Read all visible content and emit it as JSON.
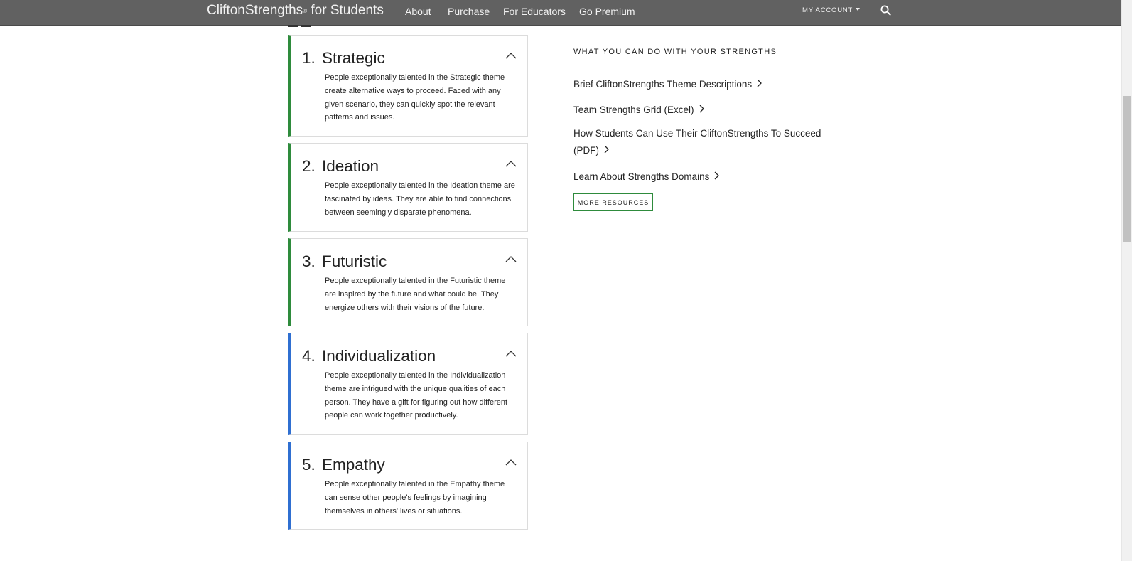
{
  "header": {
    "brand_name": "CliftonStrengths",
    "brand_trademark": "®",
    "brand_suffix": " for Students",
    "nav": [
      "About",
      "Purchase",
      "For Educators",
      "Go Premium"
    ],
    "account_label": "MY ACCOUNT",
    "search_icon": "search-icon",
    "background_color": "#616161"
  },
  "themes": [
    {
      "number": "1.",
      "name": "Strategic",
      "description": "People exceptionally talented in the Strategic theme create alternative ways to proceed. Faced with any given scenario, they can quickly spot the relevant patterns and issues.",
      "accent_color": "#2e8b3c"
    },
    {
      "number": "2.",
      "name": "Ideation",
      "description": "People exceptionally talented in the Ideation theme are fascinated by ideas. They are able to find connections between seemingly disparate phenomena.",
      "accent_color": "#2e8b3c"
    },
    {
      "number": "3.",
      "name": "Futuristic",
      "description": "People exceptionally talented in the Futuristic theme are inspired by the future and what could be. They energize others with their visions of the future.",
      "accent_color": "#2e8b3c"
    },
    {
      "number": "4.",
      "name": "Individualization",
      "description": "People exceptionally talented in the Individualization theme are intrigued with the unique qualities of each person. They have a gift for figuring out how different people can work together productively.",
      "accent_color": "#2f6fd1"
    },
    {
      "number": "5.",
      "name": "Empathy",
      "description": "People exceptionally talented in the Empathy theme can sense other people's feelings by imagining themselves in others' lives or situations.",
      "accent_color": "#2f6fd1"
    }
  ],
  "resources": {
    "heading": "WHAT YOU CAN DO WITH YOUR STRENGTHS",
    "links": [
      "Brief CliftonStrengths Theme Descriptions",
      "Team Strengths Grid (Excel)",
      "How Students Can Use Their CliftonStrengths To Succeed (PDF)",
      "Learn About Strengths Domains"
    ],
    "more_button": "MORE RESOURCES",
    "button_border_color": "#2e8b3c"
  }
}
